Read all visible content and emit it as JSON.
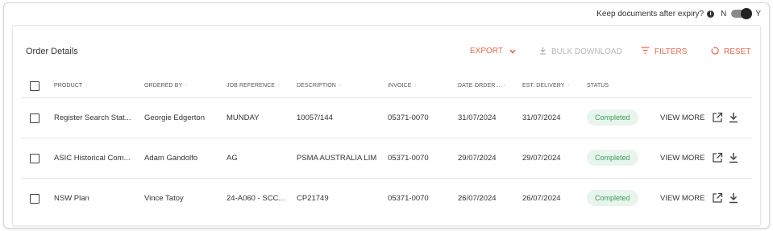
{
  "topbar": {
    "keep_label": "Keep documents after expiry?",
    "info_icon": "info-icon",
    "toggle_off_label": "N",
    "toggle_on_label": "Y",
    "toggle_state": "Y"
  },
  "card": {
    "title": "Order Details",
    "actions": {
      "export": "EXPORT",
      "bulk_download": "BULK DOWNLOAD",
      "filters": "FILTERS",
      "reset": "RESET"
    }
  },
  "table": {
    "columns": [
      "PRODUCT",
      "ORDERED BY",
      "JOB REFERENCE",
      "DESCRIPTION",
      "INVOICE",
      "DATE ORDER...",
      "EST. DELIVERY",
      "STATUS"
    ],
    "rows": [
      {
        "product": "Register Search Stat...",
        "ordered_by": "Georgie Edgerton",
        "job_reference": "MUNDAY",
        "description": "10057/144",
        "invoice": "05371-0070",
        "date_ordered": "31/07/2024",
        "est_delivery": "31/07/2024",
        "status": "Completed",
        "view_more": "VIEW MORE"
      },
      {
        "product": "ASIC Historical Com...",
        "ordered_by": "Adam Gandolfo",
        "job_reference": "AG",
        "description": "PSMA AUSTRALIA LIM",
        "invoice": "05371-0070",
        "date_ordered": "29/07/2024",
        "est_delivery": "29/07/2024",
        "status": "Completed",
        "view_more": "VIEW MORE"
      },
      {
        "product": "NSW Plan",
        "ordered_by": "Vince Tatoy",
        "job_reference": "24-A060 - SCC...",
        "description": "CP21749",
        "invoice": "05371-0070",
        "date_ordered": "26/07/2024",
        "est_delivery": "26/07/2024",
        "status": "Completed",
        "view_more": "VIEW MORE"
      }
    ]
  },
  "colors": {
    "accent": "#e8664a",
    "disabled": "#b5b5b5",
    "status_bg": "#e8f5ec",
    "status_text": "#3f9a5b"
  }
}
